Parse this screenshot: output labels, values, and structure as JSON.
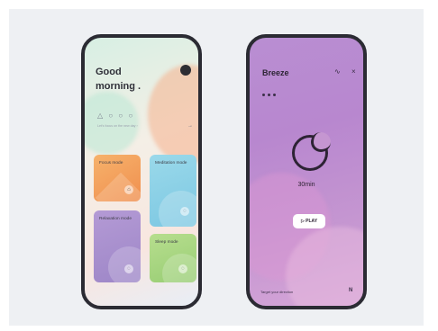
{
  "phone1": {
    "greeting_line1": "Good",
    "greeting_line2": "morning .",
    "mood_icons": "△ ○ ○ ○",
    "subtitle": "Let's focus on the new day ›",
    "arrow": "→",
    "cards": [
      {
        "label": "Focus mode",
        "icon": "⌂"
      },
      {
        "label": "Meditation mode",
        "icon": "◌"
      },
      {
        "label": "Relaxation mode",
        "icon": "◌"
      },
      {
        "label": "Sleep mode",
        "icon": "◌"
      }
    ]
  },
  "phone2": {
    "title": "Breeze",
    "pulse_icon": "∿",
    "close_icon": "×",
    "duration": "30min",
    "play_label": "▷ PLAY",
    "footer_text": "Target your direction",
    "footer_right": "N"
  },
  "colors": {
    "focus": "#f6a25e",
    "meditation": "#8fd3e8",
    "relaxation": "#a993cf",
    "sleep": "#a7d67f",
    "player_bg": "#bf8fd1"
  }
}
